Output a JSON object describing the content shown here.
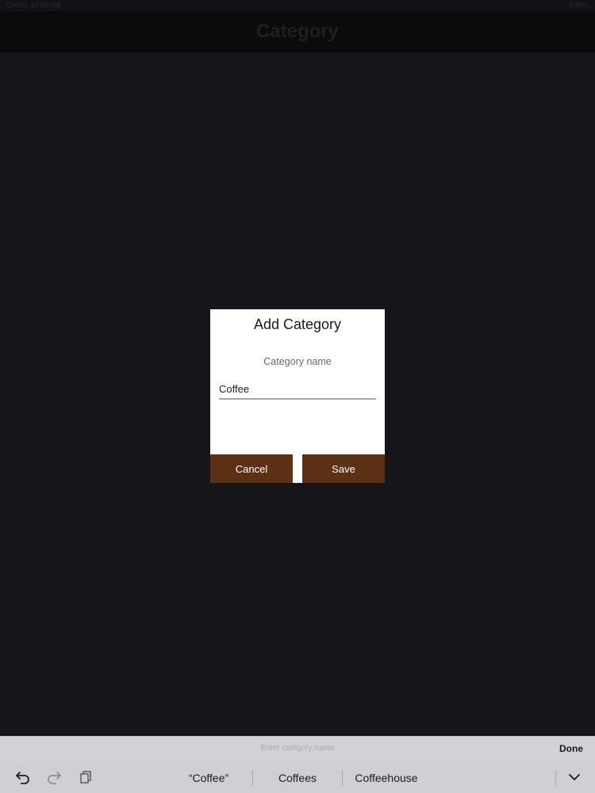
{
  "status_bar": {
    "left": "Carrier 10:30 AM",
    "right": "100%"
  },
  "nav": {
    "title": "Category"
  },
  "dialog": {
    "title": "Add Category",
    "field_label": "Category name",
    "field_value": "Coffee",
    "cancel_label": "Cancel",
    "save_label": "Save"
  },
  "accessory": {
    "placeholder": "Enter category name",
    "done_label": "Done"
  },
  "suggestions": [
    "“Coffee”",
    "Coffees",
    "Coffeehouse"
  ],
  "icons": {
    "undo": "undo-icon",
    "redo": "redo-icon",
    "paste": "paste-icon",
    "dismiss": "chevron-down-icon"
  },
  "colors": {
    "button_bg": "#5c3014",
    "dialog_bg": "#ffffff",
    "overlay_bg": "#161618"
  }
}
